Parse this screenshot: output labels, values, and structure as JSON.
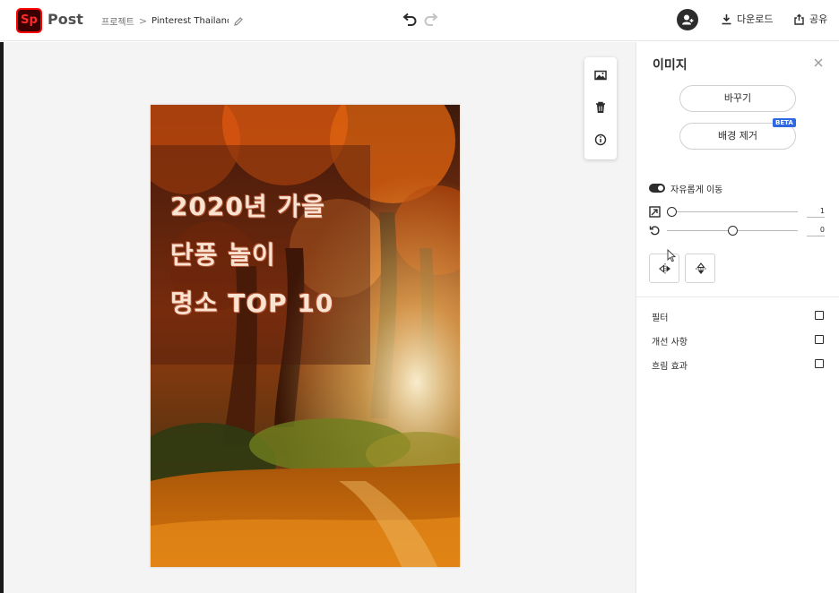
{
  "header": {
    "logo_text": "Sp",
    "app_name": "Post",
    "breadcrumb_project": "프로젝트",
    "breadcrumb_separator": ">",
    "document_name": "Pinterest Thailand t",
    "download_label": "다운로드",
    "share_label": "공유"
  },
  "artboard": {
    "headline_lines": [
      "2020년 가을",
      "단풍 놀이",
      "명소 TOP 10"
    ]
  },
  "float_toolbar": {
    "icons": [
      "image-icon",
      "trash-icon",
      "info-icon"
    ]
  },
  "panel": {
    "title": "이미지",
    "replace_label": "바꾸기",
    "remove_bg_label": "배경 제거",
    "beta_badge": "BETA",
    "free_move_label": "자유롭게 이동",
    "free_move_on": true,
    "scale_value": "1",
    "rotate_value": "0",
    "options": {
      "filter": "필터",
      "adjustments": "개선 사항",
      "blur": "흐림 효과"
    }
  },
  "colors": {
    "brand_red": "#ff0000",
    "beta_blue": "#2d68e0",
    "text_dark": "#2c2c2c"
  }
}
